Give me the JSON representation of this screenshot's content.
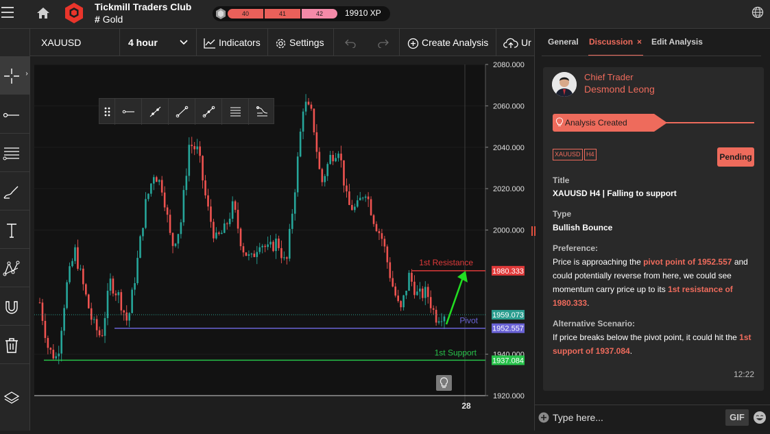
{
  "header": {
    "club_name": "Tickmill Traders Club",
    "sub_label": "Gold",
    "sub_icon": "hash-icon",
    "xp_levels": [
      "40",
      "41",
      "42"
    ],
    "xp_text": "19910 XP",
    "colors": {
      "brand": "#e9352b",
      "accent": "#ee6b5c",
      "xp_pink": "#f48aa8"
    }
  },
  "toolbar": {
    "symbol": "XAUUSD",
    "interval": "4 hour",
    "indicators": "Indicators",
    "settings": "Settings",
    "create_analysis": "Create Analysis",
    "truncated": "Ur"
  },
  "chart": {
    "y_ticks": [
      "2080.000",
      "2060.000",
      "2040.000",
      "2020.000",
      "2000.000",
      "1940.000",
      "1920.000"
    ],
    "x_label": "28",
    "resistance_label": "1st Resistance",
    "pivot_label": "Pivot",
    "support_label": "1st Support",
    "resistance_price": "1980.333",
    "current_price": "1959.073",
    "pivot_price": "1952.557",
    "support_price": "1937.084",
    "colors": {
      "resistance": "#e03a3a",
      "pivot": "#6a63d6",
      "support": "#27c24a",
      "current": "#2a9d8f",
      "arrow": "#22dd22",
      "bull": "#26a69a",
      "bear": "#ef5350"
    }
  },
  "chart_data": {
    "type": "line",
    "title": "",
    "xlabel": "",
    "ylabel": "",
    "ylim": [
      1920,
      2080
    ],
    "x_ticks": [
      "28"
    ],
    "series": [
      {
        "values": [
          1965,
          1942,
          1938,
          1972,
          1990,
          1972,
          1955,
          1948,
          1975,
          1968,
          1955,
          1982,
          2012,
          2028,
          2020,
          1992,
          2002,
          2042,
          2038,
          2012,
          1995,
          2000,
          2012,
          1992,
          1985,
          1995,
          1990,
          1995,
          1982,
          2020,
          2062,
          2055,
          2022,
          2035,
          2040,
          2012,
          2010,
          2020,
          2005,
          1995,
          1975,
          1960,
          1978,
          1968,
          1970,
          1958,
          1960
        ]
      }
    ],
    "horizontal_lines": [
      {
        "name": "1st Resistance",
        "value": 1980.333
      },
      {
        "name": "Pivot",
        "value": 1952.557
      },
      {
        "name": "1st Support",
        "value": 1937.084
      }
    ],
    "current_price": 1959.073
  },
  "panel": {
    "tabs": [
      "General",
      "Discussion",
      "Edit Analysis"
    ],
    "role": "Chief Trader",
    "trader_name": "Desmond Leong",
    "status_banner": "Analysis Created",
    "tags": [
      "XAUUSD",
      "H4"
    ],
    "status": "Pending",
    "title_label": "Title",
    "title_value": "XAUUSD H4 | Falling to support",
    "type_label": "Type",
    "type_value": "Bullish Bounce",
    "preference_label": "Preference:",
    "pref_1": "Price is approaching the",
    "pref_2": "pivot point of 1952.557",
    "pref_3": "and could potentially reverse from here, we could see momentum carry price up to its",
    "pref_4": "1st resistance of 1980.333",
    "pref_5": ".",
    "alt_label": "Alternative Scenario:",
    "alt_1": "If price breaks below the pivot point, it could hit the",
    "alt_2": "1st support of 1937.084",
    "alt_3": ".",
    "time": "12:22",
    "input_placeholder": "Type here...",
    "gif_label": "GIF"
  }
}
